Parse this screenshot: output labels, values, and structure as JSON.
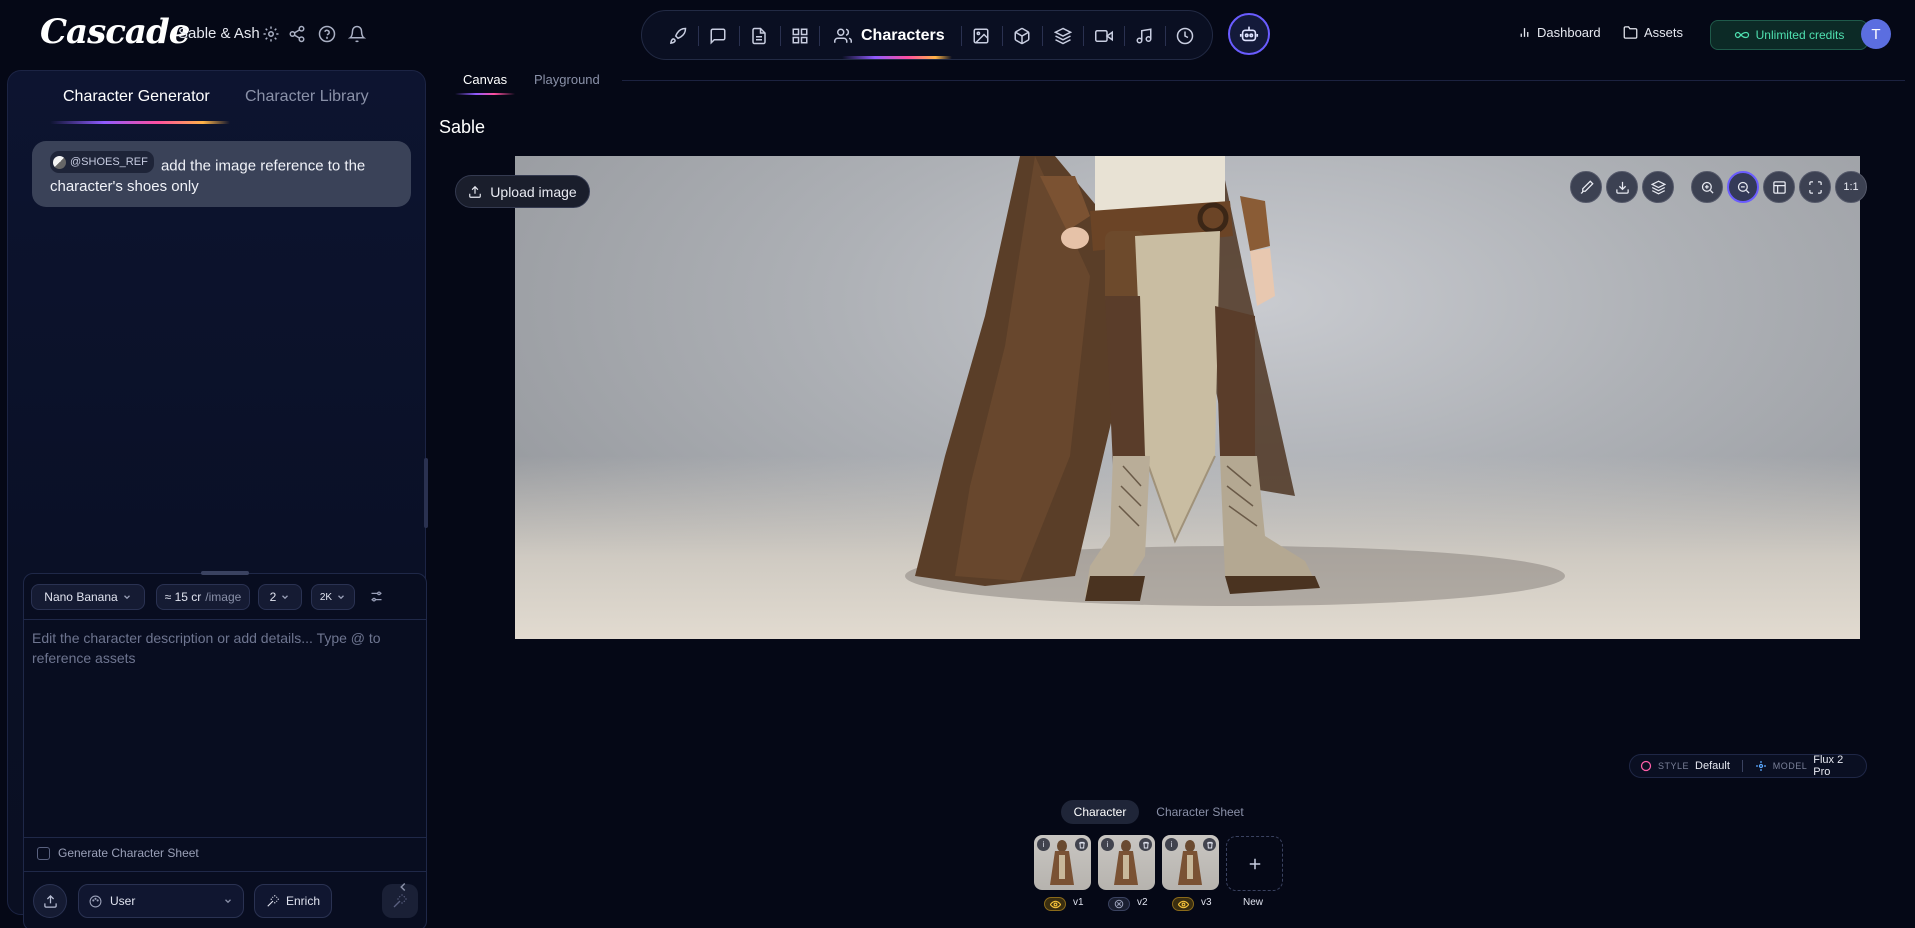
{
  "app": {
    "logo_text": "Cascade",
    "project_name": "Sable & Ash",
    "top_icons": [
      "gear-icon",
      "share-icon",
      "help-icon",
      "bell-icon"
    ]
  },
  "toolbar": {
    "active_label": "Characters",
    "icons": [
      "rocket-icon",
      "chat-icon",
      "document-icon",
      "grid-icon",
      "users-icon",
      "image-icon",
      "cube-icon",
      "layers-icon",
      "video-icon",
      "music-icon",
      "history-icon"
    ],
    "ai_button_icon": "assistant-icon"
  },
  "nav": {
    "dashboard": "Dashboard",
    "assets": "Assets",
    "credits": "Unlimited credits",
    "avatar_initial": "T"
  },
  "left_panel": {
    "tabs": [
      "Character Generator",
      "Character Library"
    ],
    "message": {
      "ref_chip": "@SHOES_REF",
      "text": "add the image reference to the character's shoes only"
    },
    "composer": {
      "model": "Nano Banana",
      "cost": "≈ 15 cr",
      "cost_unit": "/image",
      "count": "2",
      "resolution": "2K",
      "placeholder": "Edit the character description or add details... Type @ to reference assets",
      "value": "",
      "character_sheet_label": "Generate Character Sheet",
      "character_sheet_checked": false,
      "user_select": "User",
      "enrich": "Enrich"
    }
  },
  "main": {
    "tabs": [
      "Canvas",
      "Playground"
    ],
    "character_name": "Sable",
    "upload_image": "Upload image",
    "canvas_tools": [
      "brush-icon",
      "download-icon",
      "layers-icon",
      "zoom-in-icon",
      "zoom-out-icon",
      "layout-icon",
      "fullscreen-icon"
    ],
    "zoom_reset": "1:1",
    "style_label": "STYLE",
    "style_value": "Default",
    "model_label": "MODEL",
    "model_value": "Flux 2 Pro",
    "sub_tabs": [
      "Character",
      "Character Sheet"
    ],
    "versions": [
      {
        "label": "v1",
        "visible": true
      },
      {
        "label": "v2",
        "visible": false
      },
      {
        "label": "v3",
        "visible": true
      }
    ],
    "new_label": "New"
  },
  "colors": {
    "background": "#050816",
    "accent": "#6a5cff",
    "credits_green": "#4fe0b0",
    "gradient": [
      "#8f5bff",
      "#ff4fa0",
      "#ffb347"
    ]
  }
}
